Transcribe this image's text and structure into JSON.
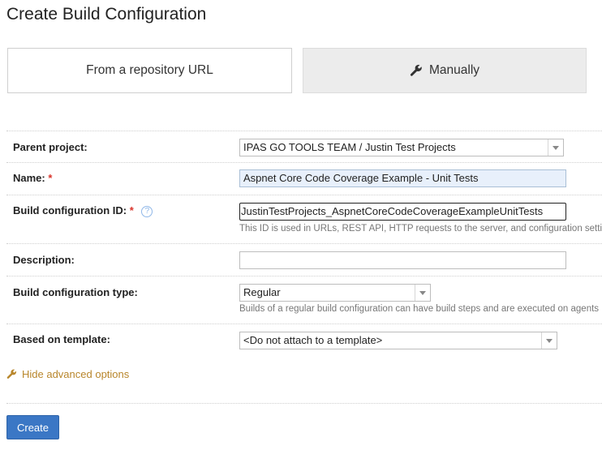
{
  "page": {
    "title": "Create Build Configuration"
  },
  "tabs": {
    "repo_label": "From a repository URL",
    "manual_label": "Manually"
  },
  "form": {
    "parent_project": {
      "label": "Parent project:",
      "value": "IPAS GO TOOLS TEAM / Justin Test Projects"
    },
    "name": {
      "label": "Name:",
      "required_mark": "*",
      "value": "Aspnet Core Code Coverage Example - Unit Tests"
    },
    "build_id": {
      "label": "Build configuration ID:",
      "required_mark": "*",
      "help": "?",
      "value": "JustinTestProjects_AspnetCoreCodeCoverageExampleUnitTests",
      "hint": "This ID is used in URLs, REST API, HTTP requests to the server, and configuration setting"
    },
    "description": {
      "label": "Description:",
      "value": ""
    },
    "build_type": {
      "label": "Build configuration type:",
      "value": "Regular",
      "hint": "Builds of a regular build configuration can have build steps and are executed on agents"
    },
    "template": {
      "label": "Based on template:",
      "value": "<Do not attach to a template>"
    }
  },
  "advanced_link": "Hide advanced options",
  "create_button": "Create",
  "colors": {
    "accent": "#3b77c5",
    "link": "#b8862b",
    "required": "#d9342b",
    "filled_field": "#e8f0fb"
  }
}
